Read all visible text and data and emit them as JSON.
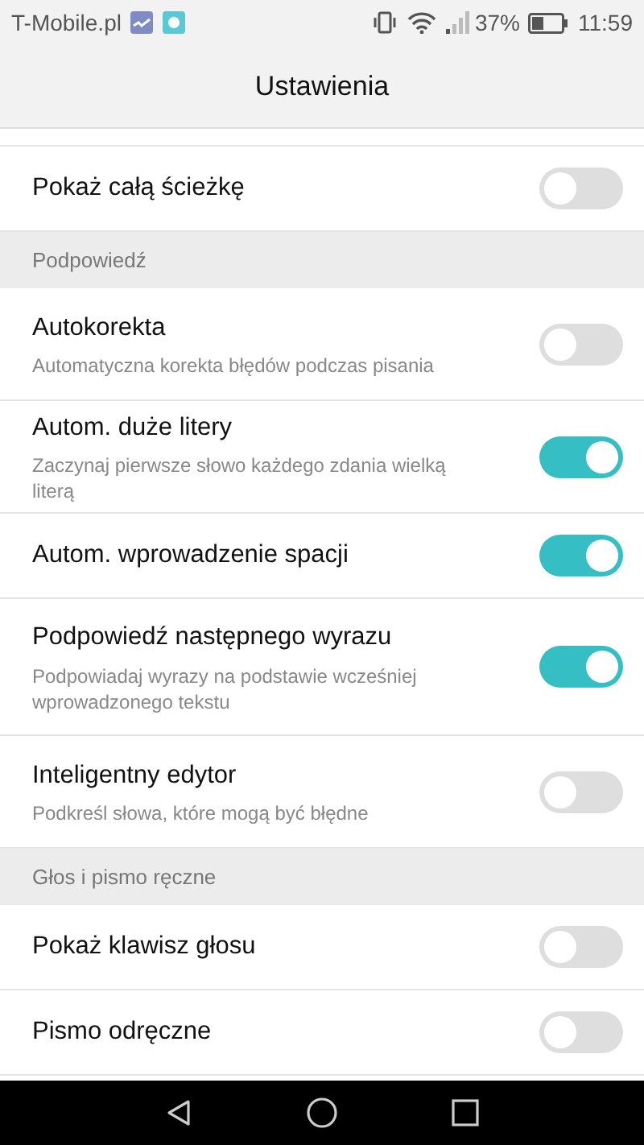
{
  "status_bar": {
    "carrier": "T-Mobile.pl",
    "battery": "37%",
    "time": "11:59"
  },
  "title": "Ustawienia",
  "items": [
    {
      "kind": "switch",
      "label": "Pokaż całą ścieżkę",
      "on": false
    },
    {
      "kind": "section",
      "label": "Podpowiedź"
    },
    {
      "kind": "switch",
      "label": "Autokorekta",
      "summary": "Automatyczna korekta błędów podczas pisania",
      "on": false
    },
    {
      "kind": "switch",
      "label": "Autom. duże litery",
      "summary": "Zaczynaj pierwsze słowo każdego zdania wielką literą",
      "on": true
    },
    {
      "kind": "switch",
      "label": "Autom. wprowadzenie spacji",
      "on": true
    },
    {
      "kind": "switch",
      "label": "Podpowiedź następnego wyrazu",
      "summary": "Podpowiadaj wyrazy na podstawie wcześniej wprowadzonego tekstu",
      "on": true
    },
    {
      "kind": "switch",
      "label": "Inteligentny edytor",
      "summary": "Podkreśl słowa, które mogą być błędne",
      "on": false
    },
    {
      "kind": "section",
      "label": "Głos i pismo ręczne"
    },
    {
      "kind": "switch",
      "label": "Pokaż klawisz głosu",
      "on": false
    },
    {
      "kind": "switch",
      "label": "Pismo odręczne",
      "on": false
    }
  ]
}
